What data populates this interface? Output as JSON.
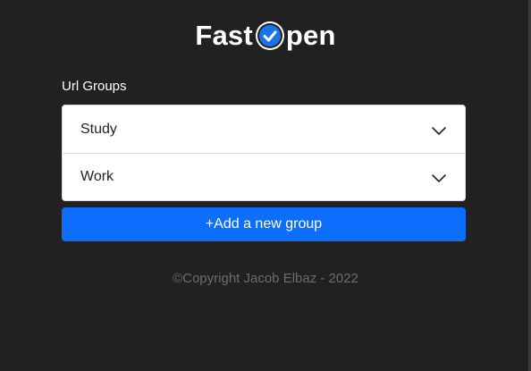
{
  "logo": {
    "prefix": "Fast",
    "icon": "check-circle-icon",
    "suffix": "pen"
  },
  "url_groups": {
    "title": "Url Groups",
    "items": [
      {
        "label": "Study",
        "icon": "chevron-down-icon"
      },
      {
        "label": "Work",
        "icon": "chevron-down-icon"
      }
    ]
  },
  "add_group": {
    "label": "+Add a new group"
  },
  "footer": {
    "copyright": "©Copyright Jacob Elbaz - 2022"
  },
  "colors": {
    "background": "#212121",
    "primary": "#0d6efd",
    "card": "#ffffff",
    "footer_text": "#6c6c6c"
  }
}
